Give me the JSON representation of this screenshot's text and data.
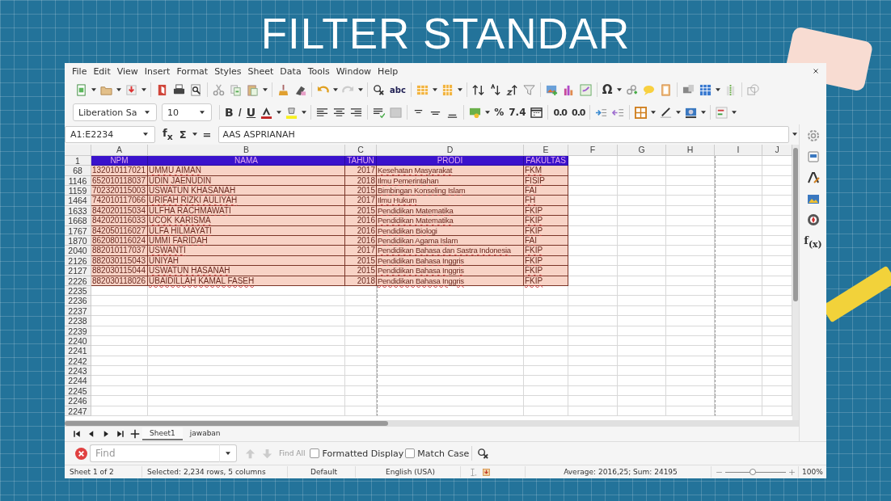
{
  "slide_title": "FILTER STANDAR",
  "menu": [
    "File",
    "Edit",
    "View",
    "Insert",
    "Format",
    "Styles",
    "Sheet",
    "Data",
    "Tools",
    "Window",
    "Help"
  ],
  "toolbar_labels": [
    "abc",
    "Ω",
    "B",
    "I",
    "U",
    "%",
    "7.4",
    "0.0",
    "0.0"
  ],
  "font_name": "Liberation Sa",
  "font_size": "10",
  "name_box": "A1:E2234",
  "formula_symbols": [
    "f$_{x}$",
    "Σ",
    "="
  ],
  "formula": "AAS ASPRIANAH",
  "columns": [
    "A",
    "B",
    "C",
    "D",
    "E",
    "F",
    "G",
    "H",
    "I",
    "J"
  ],
  "header_row": {
    "row": "1",
    "cells": [
      "NPM",
      "NAMA",
      "TAHUN",
      "PRODI",
      "FAKULTAS"
    ]
  },
  "rows": [
    {
      "row": "68",
      "cells": [
        "132010117021",
        "UMMU AIMAN",
        "2017",
        "Kesehatan Masyarakat",
        "FKM"
      ]
    },
    {
      "row": "1146",
      "cells": [
        "652010118037",
        "UDIN JAENUDIN",
        "2018",
        "Ilmu Pemerintahan",
        "FISIP"
      ]
    },
    {
      "row": "1159",
      "cells": [
        "702320115003",
        "USWATUN KHASANAH",
        "2015",
        "Bimbingan Konseling Islam",
        "FAI"
      ]
    },
    {
      "row": "1464",
      "cells": [
        "742010117066",
        "URIFAH RIZKI AULIYAH",
        "2017",
        "Ilmu Hukum",
        "FH"
      ]
    },
    {
      "row": "1633",
      "cells": [
        "842020115034",
        "ULFHA RACHMAWATI",
        "2015",
        "Pendidikan Matematika",
        "FKIP"
      ]
    },
    {
      "row": "1668",
      "cells": [
        "842020116033",
        "UCOK KARISMA",
        "2016",
        "Pendidikan Matematika",
        "FKIP"
      ]
    },
    {
      "row": "1767",
      "cells": [
        "842050116027",
        "ULFA HILMAYATI",
        "2016",
        "Pendidikan Biologi",
        "FKIP"
      ]
    },
    {
      "row": "1870",
      "cells": [
        "862080116024",
        "UMMI FARIDAH",
        "2016",
        "Pendidikan Agama Islam",
        "FAI"
      ]
    },
    {
      "row": "2040",
      "cells": [
        "882010117037",
        "USWANTI",
        "2017",
        "Pendidikan Bahasa dan Sastra Indonesia",
        "FKIP"
      ]
    },
    {
      "row": "2126",
      "cells": [
        "882030115043",
        "UNIYAH",
        "2015",
        "Pendidikan Bahasa Inggris",
        "FKIP"
      ]
    },
    {
      "row": "2127",
      "cells": [
        "882030115044",
        "USWATUN HASANAH",
        "2015",
        "Pendidikan Bahasa Inggris",
        "FKIP"
      ]
    },
    {
      "row": "2226",
      "cells": [
        "882030118026",
        "UBAIDILLAH KAMAL FASEH",
        "2018",
        "Pendidikan Bahasa Inggris",
        "FKIP"
      ]
    }
  ],
  "empty_rows": [
    "2235",
    "2236",
    "2237",
    "2238",
    "2239",
    "2240",
    "2241",
    "2242",
    "2243",
    "2244",
    "2245",
    "2246",
    "2247"
  ],
  "sheet_tabs": [
    {
      "label": "Sheet1",
      "selected": true
    },
    {
      "label": "jawaban",
      "selected": false
    }
  ],
  "find": {
    "placeholder": "Find",
    "find_all": {
      "label": "Find All",
      "disabled": true
    },
    "options": [
      {
        "label": "Formatted Display",
        "checked": false
      },
      {
        "label": "Match Case",
        "checked": false
      }
    ]
  },
  "sidebar_function_label": "f$_{(x)}$",
  "status_bar": {
    "sheet": "Sheet 1 of 2",
    "selection": "Selected: 2,234 rows, 5 columns",
    "style": "Default",
    "language": "English (USA)",
    "summary": "Average: 2016,25; Sum: 24195",
    "zoom": {
      "level": 0.45
    },
    "zoom_percent": "100%"
  }
}
